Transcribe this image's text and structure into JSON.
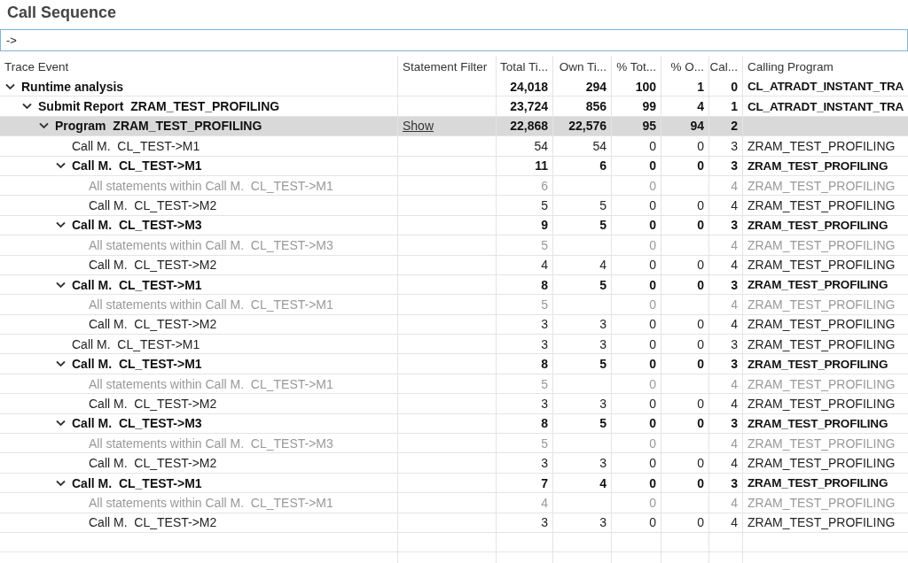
{
  "title": "Call Sequence",
  "filter": {
    "value": "->"
  },
  "columns": [
    "Trace Event",
    "Statement Filter",
    "Total Ti...",
    "Own Ti...",
    "% Tot...",
    "% O...",
    "Cal...",
    "Calling Program"
  ],
  "rows": [
    {
      "label": "Runtime analysis",
      "kind": "node",
      "expanded": true,
      "selected": false,
      "cells": [
        null,
        "24,018",
        "294",
        "100",
        "1",
        "0",
        "CL_ATRADT_INSTANT_TRA"
      ],
      "children": [
        {
          "label": "Submit Report  ZRAM_TEST_PROFILING",
          "kind": "node",
          "expanded": true,
          "selected": false,
          "cells": [
            null,
            "23,724",
            "856",
            "99",
            "4",
            "1",
            "CL_ATRADT_INSTANT_TRA"
          ],
          "children": [
            {
              "label": "Program  ZRAM_TEST_PROFILING",
              "kind": "node",
              "expanded": true,
              "selected": true,
              "cells": [
                "Show",
                "22,868",
                "22,576",
                "95",
                "94",
                "2",
                null
              ],
              "children": [
                {
                  "label": "Call M.  CL_TEST->M1",
                  "kind": "leaf",
                  "selected": false,
                  "cells": [
                    null,
                    "54",
                    "54",
                    "0",
                    "0",
                    "3",
                    "ZRAM_TEST_PROFILING"
                  ]
                },
                {
                  "label": "Call M.  CL_TEST->M1",
                  "kind": "node",
                  "expanded": true,
                  "selected": false,
                  "cells": [
                    null,
                    "11",
                    "6",
                    "0",
                    "0",
                    "3",
                    "ZRAM_TEST_PROFILING"
                  ],
                  "children": [
                    {
                      "label": "All statements within Call M.  CL_TEST->M1",
                      "kind": "statements",
                      "selected": false,
                      "cells": [
                        null,
                        "6",
                        null,
                        "0",
                        null,
                        "4",
                        "ZRAM_TEST_PROFILING"
                      ]
                    },
                    {
                      "label": "Call M.  CL_TEST->M2",
                      "kind": "leaf",
                      "selected": false,
                      "cells": [
                        null,
                        "5",
                        "5",
                        "0",
                        "0",
                        "4",
                        "ZRAM_TEST_PROFILING"
                      ]
                    }
                  ]
                },
                {
                  "label": "Call M.  CL_TEST->M3",
                  "kind": "node",
                  "expanded": true,
                  "selected": false,
                  "cells": [
                    null,
                    "9",
                    "5",
                    "0",
                    "0",
                    "3",
                    "ZRAM_TEST_PROFILING"
                  ],
                  "children": [
                    {
                      "label": "All statements within Call M.  CL_TEST->M3",
                      "kind": "statements",
                      "selected": false,
                      "cells": [
                        null,
                        "5",
                        null,
                        "0",
                        null,
                        "4",
                        "ZRAM_TEST_PROFILING"
                      ]
                    },
                    {
                      "label": "Call M.  CL_TEST->M2",
                      "kind": "leaf",
                      "selected": false,
                      "cells": [
                        null,
                        "4",
                        "4",
                        "0",
                        "0",
                        "4",
                        "ZRAM_TEST_PROFILING"
                      ]
                    }
                  ]
                },
                {
                  "label": "Call M.  CL_TEST->M1",
                  "kind": "node",
                  "expanded": true,
                  "selected": false,
                  "cells": [
                    null,
                    "8",
                    "5",
                    "0",
                    "0",
                    "3",
                    "ZRAM_TEST_PROFILING"
                  ],
                  "children": [
                    {
                      "label": "All statements within Call M.  CL_TEST->M1",
                      "kind": "statements",
                      "selected": false,
                      "cells": [
                        null,
                        "5",
                        null,
                        "0",
                        null,
                        "4",
                        "ZRAM_TEST_PROFILING"
                      ]
                    },
                    {
                      "label": "Call M.  CL_TEST->M2",
                      "kind": "leaf",
                      "selected": false,
                      "cells": [
                        null,
                        "3",
                        "3",
                        "0",
                        "0",
                        "4",
                        "ZRAM_TEST_PROFILING"
                      ]
                    }
                  ]
                },
                {
                  "label": "Call M.  CL_TEST->M1",
                  "kind": "leaf",
                  "selected": false,
                  "cells": [
                    null,
                    "3",
                    "3",
                    "0",
                    "0",
                    "3",
                    "ZRAM_TEST_PROFILING"
                  ]
                },
                {
                  "label": "Call M.  CL_TEST->M1",
                  "kind": "node",
                  "expanded": true,
                  "selected": false,
                  "cells": [
                    null,
                    "8",
                    "5",
                    "0",
                    "0",
                    "3",
                    "ZRAM_TEST_PROFILING"
                  ],
                  "children": [
                    {
                      "label": "All statements within Call M.  CL_TEST->M1",
                      "kind": "statements",
                      "selected": false,
                      "cells": [
                        null,
                        "5",
                        null,
                        "0",
                        null,
                        "4",
                        "ZRAM_TEST_PROFILING"
                      ]
                    },
                    {
                      "label": "Call M.  CL_TEST->M2",
                      "kind": "leaf",
                      "selected": false,
                      "cells": [
                        null,
                        "3",
                        "3",
                        "0",
                        "0",
                        "4",
                        "ZRAM_TEST_PROFILING"
                      ]
                    }
                  ]
                },
                {
                  "label": "Call M.  CL_TEST->M3",
                  "kind": "node",
                  "expanded": true,
                  "selected": false,
                  "cells": [
                    null,
                    "8",
                    "5",
                    "0",
                    "0",
                    "3",
                    "ZRAM_TEST_PROFILING"
                  ],
                  "children": [
                    {
                      "label": "All statements within Call M.  CL_TEST->M3",
                      "kind": "statements",
                      "selected": false,
                      "cells": [
                        null,
                        "5",
                        null,
                        "0",
                        null,
                        "4",
                        "ZRAM_TEST_PROFILING"
                      ]
                    },
                    {
                      "label": "Call M.  CL_TEST->M2",
                      "kind": "leaf",
                      "selected": false,
                      "cells": [
                        null,
                        "3",
                        "3",
                        "0",
                        "0",
                        "4",
                        "ZRAM_TEST_PROFILING"
                      ]
                    }
                  ]
                },
                {
                  "label": "Call M.  CL_TEST->M1",
                  "kind": "node",
                  "expanded": true,
                  "selected": false,
                  "cells": [
                    null,
                    "7",
                    "4",
                    "0",
                    "0",
                    "3",
                    "ZRAM_TEST_PROFILING"
                  ],
                  "children": [
                    {
                      "label": "All statements within Call M.  CL_TEST->M1",
                      "kind": "statements",
                      "selected": false,
                      "cells": [
                        null,
                        "4",
                        null,
                        "0",
                        null,
                        "4",
                        "ZRAM_TEST_PROFILING"
                      ]
                    },
                    {
                      "label": "Call M.  CL_TEST->M2",
                      "kind": "leaf",
                      "selected": false,
                      "cells": [
                        null,
                        "3",
                        "3",
                        "0",
                        "0",
                        "4",
                        "ZRAM_TEST_PROFILING"
                      ]
                    }
                  ]
                }
              ]
            }
          ]
        }
      ]
    }
  ]
}
